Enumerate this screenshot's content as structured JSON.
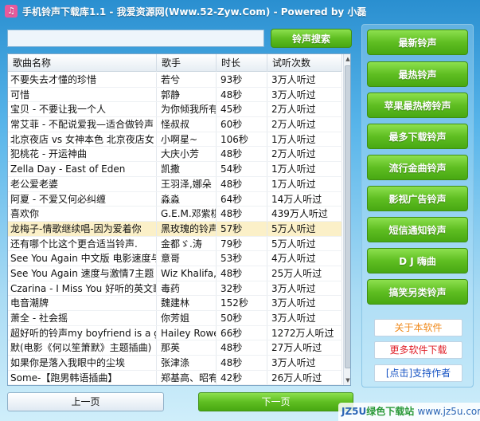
{
  "window": {
    "title": "手机铃声下载库1.1 - 我爱资源网(Www.52-Zyw.Com) - Powered by 小磊",
    "icon": "music-icon"
  },
  "search": {
    "value": "",
    "placeholder": "",
    "button_label": "铃声搜索"
  },
  "table": {
    "columns": [
      "歌曲名称",
      "歌手",
      "时长",
      "试听次数"
    ],
    "rows": [
      [
        "不要失去才懂的珍惜",
        "若兮",
        "93秒",
        "3万人听过"
      ],
      [
        "可惜",
        "郭静",
        "48秒",
        "3万人听过"
      ],
      [
        "宝贝 - 不要让我一个人",
        "为你倾我所有",
        "45秒",
        "2万人听过"
      ],
      [
        "常艾菲 - 不配说爱我—适合做铃声",
        "怪叔叔",
        "60秒",
        "2万人听过"
      ],
      [
        "北京夜店 vs 女神本色 北京夜店女",
        "小啊星~",
        "106秒",
        "1万人听过"
      ],
      [
        "犯桃花 - 开运神曲",
        "大庆小芳",
        "48秒",
        "2万人听过"
      ],
      [
        "Zella Day - East of Eden",
        "凯撒",
        "54秒",
        "1万人听过"
      ],
      [
        "老公爱老婆",
        "王羽泽,娜朵",
        "48秒",
        "1万人听过"
      ],
      [
        "阿夏 - 不爱又何必纠缠",
        "淼淼",
        "64秒",
        "14万人听过"
      ],
      [
        "喜欢你",
        "G.E.M.邓紫棋",
        "48秒",
        "439万人听过"
      ],
      [
        "龙梅子-情歌继续唱-因为爱着你",
        "黑玫瑰的铃声",
        "57秒",
        "5万人听过"
      ],
      [
        "还有哪个比这个更合适当铃声.",
        "金都ゞ.涛",
        "79秒",
        "5万人听过"
      ],
      [
        "See You Again 中文版 电影速度与",
        "意哥",
        "53秒",
        "4万人听过"
      ],
      [
        "See You Again 速度与激情7主题",
        "Wiz Khalifa,",
        "48秒",
        "25万人听过"
      ],
      [
        "Czarina - I Miss You 好听的英文歌",
        "毒药",
        "32秒",
        "3万人听过"
      ],
      [
        "电音潮牌",
        "魏建林",
        "152秒",
        "3万人听过"
      ],
      [
        "萧全 - 社会摇",
        "你芳姐",
        "50秒",
        "3万人听过"
      ],
      [
        "超好听的铃声my boyfriend is a g",
        "Hailey Rowe",
        "66秒",
        "1272万人听过"
      ],
      [
        "默(电影《何以笙箫默》主题插曲)",
        "那英",
        "48秒",
        "27万人听过"
      ],
      [
        "如果你是落入我眼中的尘埃",
        "张津涤",
        "48秒",
        "3万人听过"
      ],
      [
        "Some-【跑男韩语插曲】",
        "郑基高、昭宥",
        "42秒",
        "26万人听过"
      ]
    ],
    "selected_row": 10
  },
  "sidebar": {
    "buttons": [
      "最新铃声",
      "最热铃声",
      "苹果最热榜铃声",
      "最多下载铃声",
      "流行金曲铃声",
      "影视广告铃声",
      "短信通知铃声",
      "D J 嗨曲",
      "搞笑另类铃声"
    ],
    "links": [
      {
        "label": "关于本软件",
        "color": "#f08a1c"
      },
      {
        "label": "更多软件下载",
        "color": "#e0222a"
      },
      {
        "label": "[点击]支持作者",
        "color": "#1a56c4"
      }
    ]
  },
  "pager": {
    "prev_label": "上一页",
    "next_label": "下一页"
  },
  "watermark": {
    "brand_a": "JZ5U",
    "brand_b": "绿色下载站",
    "url": "www.jz5u.com"
  },
  "colors": {
    "accent_green": "#5fbe22",
    "selected_row": "#fbf0c8",
    "title_bar": "#2a8fd0"
  }
}
